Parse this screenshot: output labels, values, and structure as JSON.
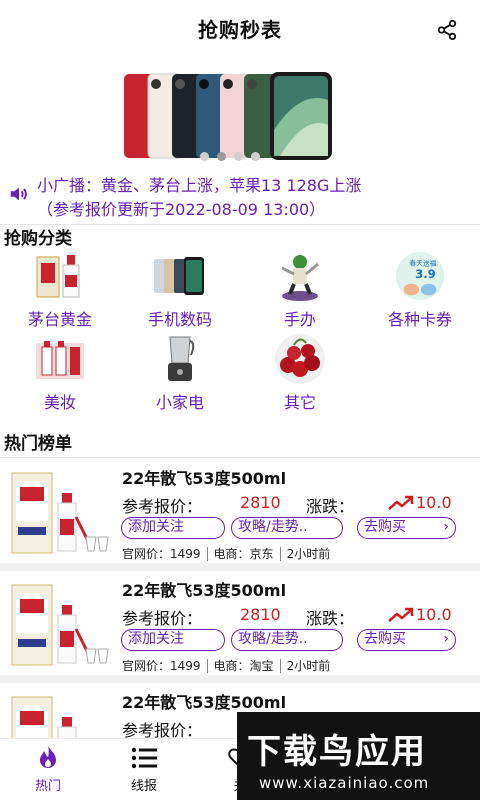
{
  "header": {
    "title": "抢购秒表",
    "share_icon": "share-icon"
  },
  "banner": {
    "slides": 4,
    "active_slide": 1
  },
  "ticker": {
    "icon": "speaker-icon",
    "line1": "小广播：黄金、茅台上涨，苹果13 128G上涨",
    "line2": "（参考报价更新于2022-08-09 13:00）"
  },
  "categories_section": {
    "title": "抢购分类",
    "items": [
      {
        "label": "茅台黄金",
        "icon": "liquor-icon"
      },
      {
        "label": "手机数码",
        "icon": "phone-icon"
      },
      {
        "label": "手办",
        "icon": "figure-icon"
      },
      {
        "label": "各种卡券",
        "icon": "coupon-icon"
      },
      {
        "label": "美妆",
        "icon": "cosmetics-icon"
      },
      {
        "label": "小家电",
        "icon": "appliance-icon"
      },
      {
        "label": "其它",
        "icon": "cherry-icon"
      }
    ],
    "coupon_badge_line1": "春天送福",
    "coupon_badge_line2": "3.9"
  },
  "hot_section": {
    "title": "热门榜单",
    "items": [
      {
        "name": "22年散飞53度500ml",
        "price_label": "参考报价：",
        "price": "2810",
        "change_label": "涨跌：",
        "change": "10.0",
        "btn_follow": "添加关注",
        "btn_guide": "攻略/走势..",
        "btn_buy": "去购买",
        "official_price": "官网价：1499",
        "platform": "电商：京东",
        "time": "2小时前"
      },
      {
        "name": "22年散飞53度500ml",
        "price_label": "参考报价：",
        "price": "2810",
        "change_label": "涨跌：",
        "change": "10.0",
        "btn_follow": "添加关注",
        "btn_guide": "攻略/走势..",
        "btn_buy": "去购买",
        "official_price": "官网价：1499",
        "platform": "电商：淘宝",
        "time": "2小时前"
      },
      {
        "name": "22年散飞53度500ml",
        "price_label": "参考报价："
      }
    ]
  },
  "tabbar": {
    "tabs": [
      {
        "label": "热门",
        "icon": "flame-icon",
        "active": true
      },
      {
        "label": "线报",
        "icon": "list-icon",
        "active": false
      },
      {
        "label": "关",
        "icon": "heart-icon",
        "active": false
      }
    ]
  },
  "watermark": {
    "main": "下载鸟应用",
    "sub": "www.xiazainiao.com"
  },
  "colors": {
    "accent": "#6a1fb5",
    "price_red": "#d31b1b",
    "text": "#111111"
  }
}
